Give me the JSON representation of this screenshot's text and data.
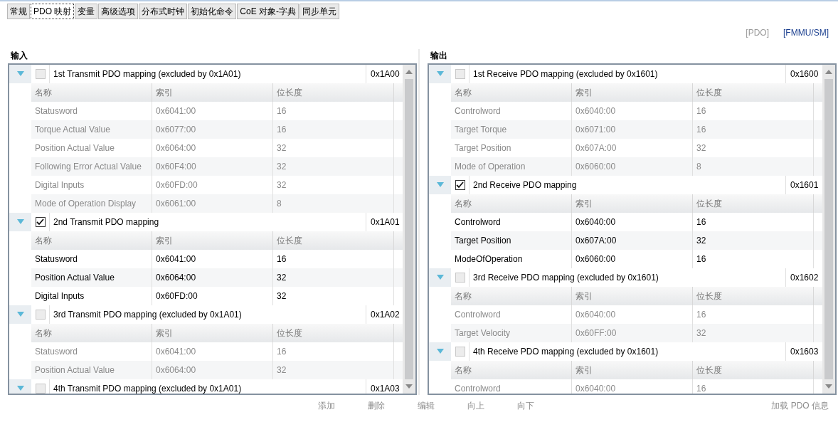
{
  "tabs": [
    {
      "label": "常规",
      "selected": false
    },
    {
      "label": "PDO 映射",
      "selected": true
    },
    {
      "label": "变量",
      "selected": false
    },
    {
      "label": "高级选项",
      "selected": false
    },
    {
      "label": "分布式时钟",
      "selected": false
    },
    {
      "label": "初始化命令",
      "selected": false
    },
    {
      "label": "CoE 对象-字典",
      "selected": false
    },
    {
      "label": "同步单元",
      "selected": false
    }
  ],
  "view_links": [
    {
      "label": "[PDO]",
      "disabled": true
    },
    {
      "label": "[FMMU/SM]",
      "disabled": false
    }
  ],
  "panels": [
    {
      "title": "输入",
      "groups": [
        {
          "title": "1st Transmit PDO mapping (excluded by 0x1A01)",
          "index": "0x1A00",
          "checked": false,
          "expanded": true,
          "columns": [
            "名称",
            "索引",
            "位长度"
          ],
          "rows": [
            [
              "Statusword",
              "0x6041:00",
              "16"
            ],
            [
              "Torque Actual Value",
              "0x6077:00",
              "16"
            ],
            [
              "Position Actual Value",
              "0x6064:00",
              "32"
            ],
            [
              "Following Error Actual Value",
              "0x60F4:00",
              "32"
            ],
            [
              "Digital Inputs",
              "0x60FD:00",
              "32"
            ],
            [
              "Mode of Operation Display",
              "0x6061:00",
              "8"
            ]
          ]
        },
        {
          "title": "2nd Transmit PDO mapping",
          "index": "0x1A01",
          "checked": true,
          "expanded": true,
          "columns": [
            "名称",
            "索引",
            "位长度"
          ],
          "rows": [
            [
              "Statusword",
              "0x6041:00",
              "16"
            ],
            [
              "Position Actual Value",
              "0x6064:00",
              "32"
            ],
            [
              "Digital Inputs",
              "0x60FD:00",
              "32"
            ]
          ]
        },
        {
          "title": "3rd Transmit PDO mapping (excluded by 0x1A01)",
          "index": "0x1A02",
          "checked": false,
          "expanded": true,
          "columns": [
            "名称",
            "索引",
            "位长度"
          ],
          "rows": [
            [
              "Statusword",
              "0x6041:00",
              "16"
            ],
            [
              "Position Actual Value",
              "0x6064:00",
              "32"
            ]
          ]
        },
        {
          "title": "4th Transmit PDO mapping (excluded by 0x1A01)",
          "index": "0x1A03",
          "checked": false,
          "expanded": true
        }
      ]
    },
    {
      "title": "输出",
      "groups": [
        {
          "title": "1st Receive PDO mapping (excluded by 0x1601)",
          "index": "0x1600",
          "checked": false,
          "expanded": true,
          "columns": [
            "名称",
            "索引",
            "位长度"
          ],
          "rows": [
            [
              "Controlword",
              "0x6040:00",
              "16"
            ],
            [
              "Target Torque",
              "0x6071:00",
              "16"
            ],
            [
              "Target Position",
              "0x607A:00",
              "32"
            ],
            [
              "Mode of Operation",
              "0x6060:00",
              "8"
            ]
          ]
        },
        {
          "title": "2nd Receive PDO mapping",
          "index": "0x1601",
          "checked": true,
          "expanded": true,
          "columns": [
            "名称",
            "索引",
            "位长度"
          ],
          "rows": [
            [
              "Controlword",
              "0x6040:00",
              "16"
            ],
            [
              "Target Position",
              "0x607A:00",
              "32"
            ],
            [
              "ModeOfOperation",
              "0x6060:00",
              "16"
            ]
          ]
        },
        {
          "title": "3rd Receive PDO mapping (excluded by 0x1601)",
          "index": "0x1602",
          "checked": false,
          "expanded": true,
          "columns": [
            "名称",
            "索引",
            "位长度"
          ],
          "rows": [
            [
              "Controlword",
              "0x6040:00",
              "16"
            ],
            [
              "Target Velocity",
              "0x60FF:00",
              "32"
            ]
          ]
        },
        {
          "title": "4th Receive PDO mapping (excluded by 0x1601)",
          "index": "0x1603",
          "checked": false,
          "expanded": true,
          "columns": [
            "名称",
            "索引",
            "位长度"
          ],
          "rows": [
            [
              "Controlword",
              "0x6040:00",
              "16"
            ]
          ]
        }
      ]
    }
  ],
  "edit_buttons": [
    {
      "label": "添加",
      "disabled": true
    },
    {
      "label": "删除",
      "disabled": true
    },
    {
      "label": "编辑",
      "disabled": true
    },
    {
      "label": "向上",
      "disabled": true
    },
    {
      "label": "向下",
      "disabled": true
    }
  ],
  "load_button": {
    "label": "加载 PDO 信息",
    "disabled": true
  }
}
